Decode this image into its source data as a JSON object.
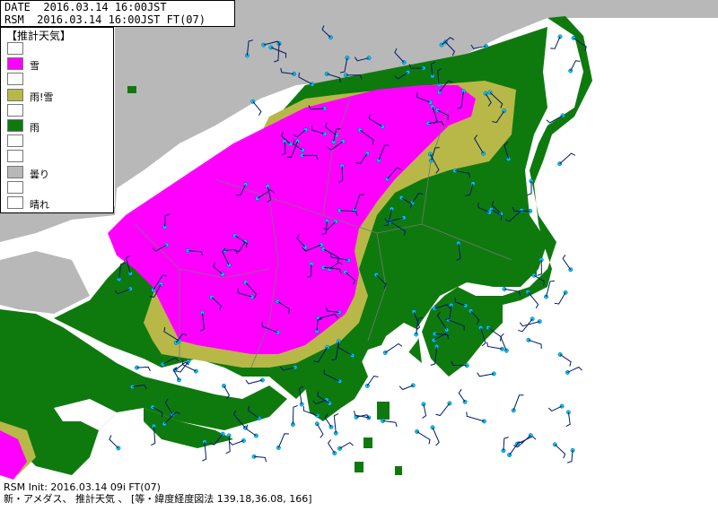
{
  "header": {
    "date_line": "DATE  2016.03.14 16:00JST",
    "rsm_line": "RSM  2016.03.14 16:00JST FT(07)"
  },
  "legend": {
    "title": "【推計天気】",
    "items": [
      {
        "label": "",
        "color": "#ffffff"
      },
      {
        "label": "雪",
        "color": "#ff00ff"
      },
      {
        "label": "",
        "color": "#ffffff"
      },
      {
        "label": "雨!雪",
        "color": "#b8b848"
      },
      {
        "label": "",
        "color": "#ffffff"
      },
      {
        "label": "雨",
        "color": "#0e7a0e"
      },
      {
        "label": "",
        "color": "#ffffff"
      },
      {
        "label": "",
        "color": "#ffffff"
      },
      {
        "label": "曇り",
        "color": "#b8b8b8"
      },
      {
        "label": "",
        "color": "#ffffff"
      },
      {
        "label": "晴れ",
        "color": "#ffffff"
      }
    ]
  },
  "footer": {
    "line1": "RSM Init: 2016.03.14 09i FT(07)",
    "line2": "新・アメダス、 推計天気 、 [等・緯度経度図法 139.18,36.08, 166]"
  },
  "colors": {
    "snow": "#ff00ff",
    "sleet": "#b8b848",
    "rain": "#0e7a0e",
    "cloud": "#b8b8b8",
    "sea": "#ffffff",
    "station": "#00ccff",
    "barb": "#001a66"
  }
}
